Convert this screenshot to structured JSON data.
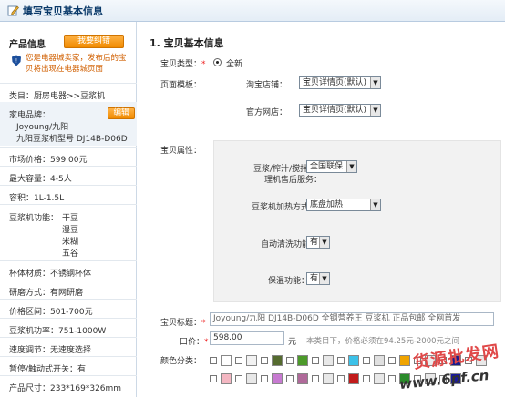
{
  "header": {
    "title": "填写宝贝基本信息"
  },
  "left_panel": {
    "title": "产品信息",
    "correct_button": "我要纠错",
    "notice": "您是电器城卖家，发布后的宝贝将出现在电器城页面",
    "category": "类目：厨房电器>>豆浆机",
    "brand_label": "家电品牌：",
    "edit_button": "编辑",
    "brand_value": "Joyoung/九阳",
    "model_value": "九阳豆浆机型号 DJ14B-D06D",
    "market_price": "市场价格：599.00元",
    "max_capacity": "最大容量：4-5人",
    "volume": "容积：1L-1.5L",
    "functions_label": "豆浆机功能：",
    "functions": [
      "干豆",
      "湿豆",
      "米糊",
      "五谷"
    ],
    "cup_material": "杯体材质：不锈钢杯体",
    "grind": "研磨方式：有网研磨",
    "price_range": "价格区间：501-700元",
    "power": "豆浆机功率：751-1000W",
    "speed": "速度调节：无速度选择",
    "pause": "暂停/触动式开关：有",
    "size": "产品尺寸：233*169*326mm"
  },
  "main": {
    "section_title": "1. 宝贝基本信息",
    "type_label": "宝贝类型：",
    "type_value": "全新",
    "template_label": "页面模板：",
    "taobao_label": "淘宝店铺：",
    "taobao_value": "宝贝详情页(默认)",
    "official_label": "官方网店：",
    "official_value": "宝贝详情页(默认)",
    "attr_label": "宝贝属性：",
    "service_label_1": "豆浆/榨汁/搅拌/料",
    "service_label_2": "理机售后服务：",
    "service_value": "全国联保",
    "heating_label": "豆浆机加热方式：",
    "heating_value": "底盘加热",
    "autoclean_label": "自动清洗功能：",
    "autoclean_value": "有",
    "keepwarm_label": "保温功能：",
    "keepwarm_value": "有",
    "title_label": "宝贝标题：",
    "title_value": "Joyoung/九阳 DJ14B-D06D 全钢营养王 豆浆机 正品包邮 全网首发",
    "price_label": "一口价：",
    "price_value": "598.00",
    "price_unit": "元",
    "price_hint": "本类目下，价格必须在94.25元-2000元之间",
    "color_label": "颜色分类："
  },
  "swatch_colors": {
    "row1": [
      "#ffffff",
      "#f2f2f2",
      "#556b2f",
      "#4c9a2a",
      "#e8e8e8",
      "#3cc1e8",
      "#e0e0e0",
      "#f0a400",
      "#ececec",
      "#1c1c8c",
      "#e8e8e8"
    ],
    "row2": [
      "#f4b7c2",
      "#e8e8e8",
      "#c77ad1",
      "#b06a9a",
      "#e8e8e8",
      "#c21b1b",
      "#e8e8e8",
      "#2a8a2a",
      "#e8e8e8",
      "#1a1aa0"
    ]
  },
  "watermark": {
    "line1": "货源批发网",
    "line2": "www.6pf.cn"
  }
}
